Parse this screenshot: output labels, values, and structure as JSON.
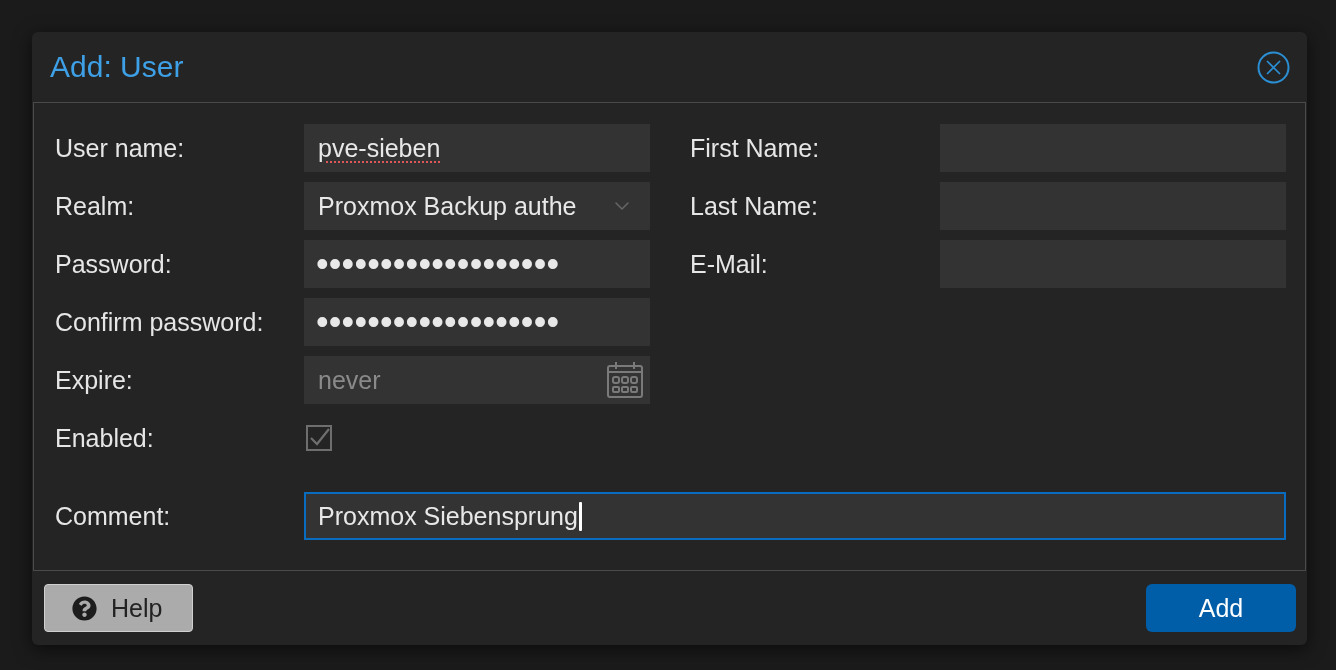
{
  "dialog": {
    "title": "Add: User"
  },
  "left_fields": [
    {
      "kind": "text",
      "label": "User name:",
      "value": "pve-sieben",
      "spellcheck_error": true
    },
    {
      "kind": "select",
      "label": "Realm:",
      "value": "Proxmox Backup authe"
    },
    {
      "kind": "password",
      "label": "Password:",
      "value": "•••••••••••••••••••"
    },
    {
      "kind": "password",
      "label": "Confirm password:",
      "value": "•••••••••••••••••••"
    },
    {
      "kind": "date",
      "label": "Expire:",
      "placeholder": "never"
    },
    {
      "kind": "checkbox",
      "label": "Enabled:",
      "checked": true
    }
  ],
  "right_fields": [
    {
      "kind": "text",
      "label": "First Name:"
    },
    {
      "kind": "text",
      "label": "Last Name:"
    },
    {
      "kind": "text",
      "label": "E-Mail:"
    }
  ],
  "comment": {
    "label": "Comment:",
    "value": "Proxmox Siebensprung",
    "focused": true
  },
  "buttons": [
    {
      "kind": "help",
      "label": "Help"
    },
    {
      "kind": "primary",
      "label": "Add"
    }
  ]
}
